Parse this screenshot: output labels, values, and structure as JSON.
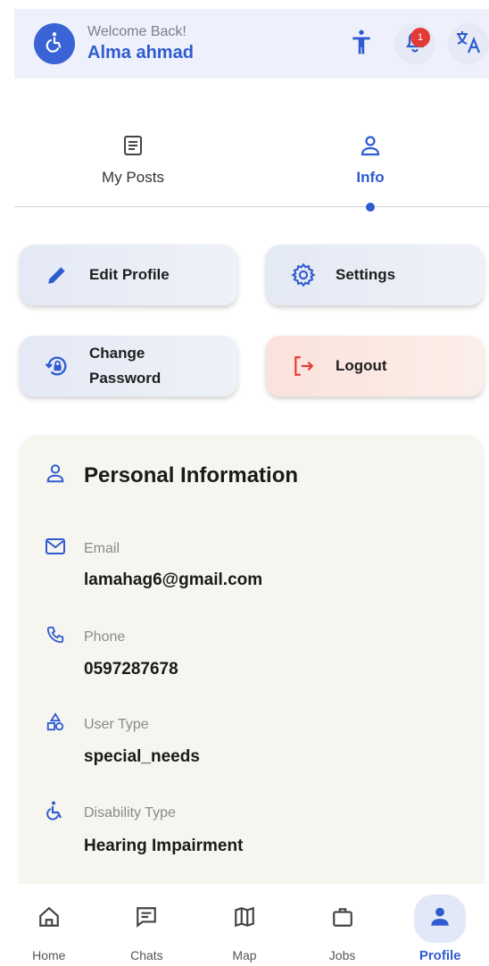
{
  "header": {
    "welcome": "Welcome Back!",
    "user_name": "Alma ahmad",
    "notification_count": "1",
    "icons": [
      "accessibility-icon",
      "bell-icon",
      "translate-icon"
    ]
  },
  "tabs": [
    {
      "label": "My Posts",
      "icon": "posts-icon",
      "active": false
    },
    {
      "label": "Info",
      "icon": "person-icon",
      "active": true
    }
  ],
  "actions": {
    "edit_profile": "Edit Profile",
    "settings": "Settings",
    "change_password_line1": "Change",
    "change_password_line2": "Password",
    "logout": "Logout"
  },
  "personal_info": {
    "title": "Personal Information",
    "items": [
      {
        "label": "Email",
        "value": "lamahag6@gmail.com",
        "icon": "mail-icon"
      },
      {
        "label": "Phone",
        "value": "0597287678",
        "icon": "phone-icon"
      },
      {
        "label": "User Type",
        "value": "special_needs",
        "icon": "category-icon"
      },
      {
        "label": "Disability Type",
        "value": "Hearing Impairment",
        "icon": "wheelchair-icon"
      }
    ]
  },
  "nav": {
    "home": "Home",
    "chats": "Chats",
    "map": "Map",
    "jobs": "Jobs",
    "profile": "Profile",
    "active": "Profile"
  },
  "colors": {
    "accent": "#2f5bd1",
    "badge": "#e53935",
    "logout": "#e53935",
    "card": "#f6f5ef"
  }
}
